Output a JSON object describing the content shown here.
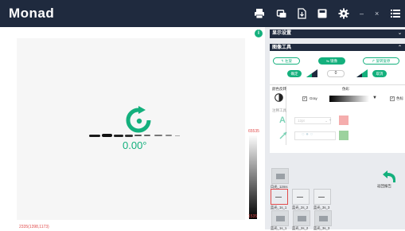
{
  "app": {
    "title": "Monad"
  },
  "toolbar": {
    "icons": [
      "printer-icon",
      "copy-icon",
      "export-icon",
      "save-icon",
      "gear-icon",
      "minimize-icon",
      "close-icon",
      "menu-list-icon"
    ],
    "minimize": "–",
    "close": "×"
  },
  "viewer": {
    "angle": "0.00°",
    "scale_max": "65535",
    "scale_min": "1535",
    "coords": "2335(1398,1173)"
  },
  "panel": {
    "display_settings": "显示设置",
    "image_tools": "图像工具",
    "rotate_left": "↰ 左旋",
    "mirror": "⇋ 镜像",
    "rotate_right": "↱ 旋转复原",
    "confirm": "确定",
    "angle_value": "0",
    "cancel": "取消",
    "color_invert": "颜色反转",
    "pseudocolor": "伪彩",
    "gray_label": "Gray",
    "color_label": "色标",
    "annotation_tools": "注释工具",
    "font_size": "12pt"
  },
  "thumbnails": {
    "top": [
      {
        "caption": "白光_12ms"
      }
    ],
    "row1": [
      {
        "caption": "蓝光_1s_1",
        "selected": true
      },
      {
        "caption": "蓝光_2s_2",
        "selected": false
      },
      {
        "caption": "蓝光_3s_3",
        "selected": false
      }
    ],
    "row2": [
      {
        "caption": "蓝光_1s_1"
      },
      {
        "caption": "蓝光_2s_2"
      },
      {
        "caption": "蓝光_3s_3"
      }
    ],
    "back_label": "返回报告"
  },
  "colors": {
    "accent": "#14b07d",
    "header": "#1f2a3e",
    "alert": "#e14b4b"
  }
}
